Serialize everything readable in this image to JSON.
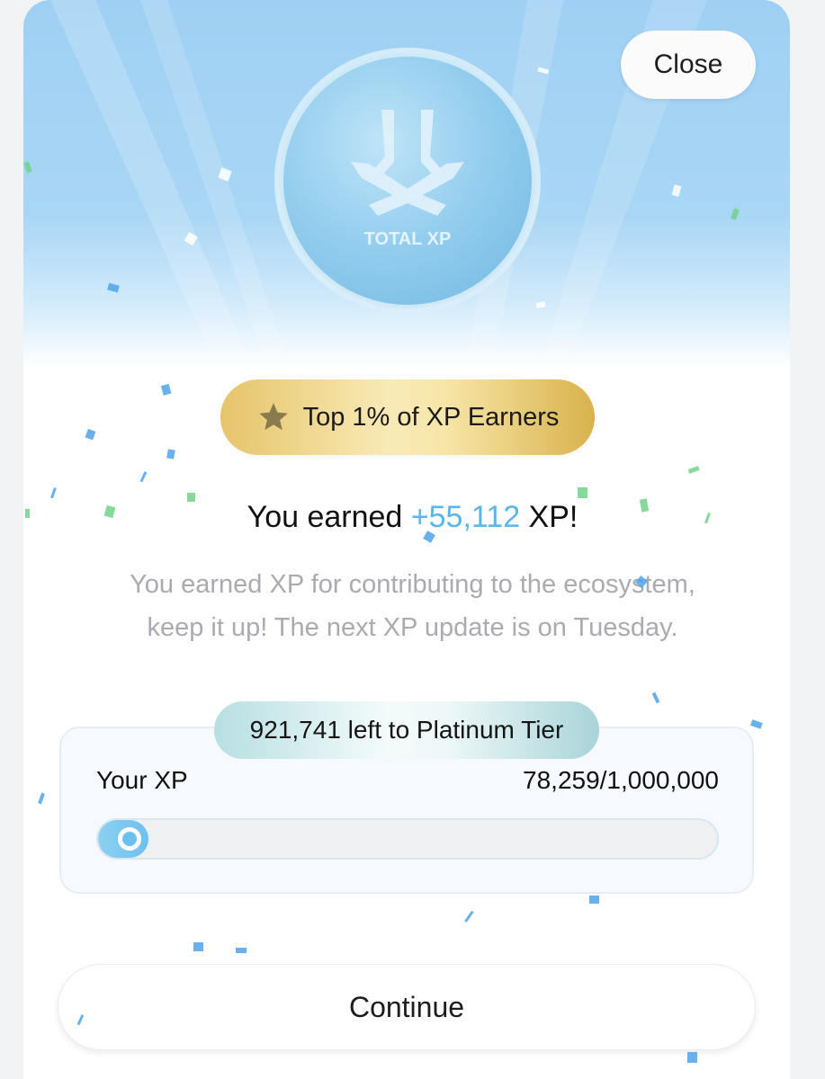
{
  "header": {
    "close_label": "Close"
  },
  "coin": {
    "label": "TOTAL XP"
  },
  "badge": {
    "icon": "star-icon",
    "text": "Top 1% of XP Earners"
  },
  "headline": {
    "prefix": "You earned ",
    "amount": "+55,112",
    "suffix": " XP!"
  },
  "description": {
    "line1": "You earned XP for contributing to the ecosystem,",
    "line2": "keep it up! The next XP update is on Tuesday."
  },
  "progress": {
    "tier_message": "921,741 left to Platinum Tier",
    "label": "Your XP",
    "value_text": "78,259/1,000,000",
    "current": 78259,
    "max": 1000000
  },
  "footer": {
    "continue_label": "Continue"
  },
  "colors": {
    "accent": "#5ab5ea",
    "gold": "#e6c46a",
    "progress": "#6ec0ef"
  }
}
